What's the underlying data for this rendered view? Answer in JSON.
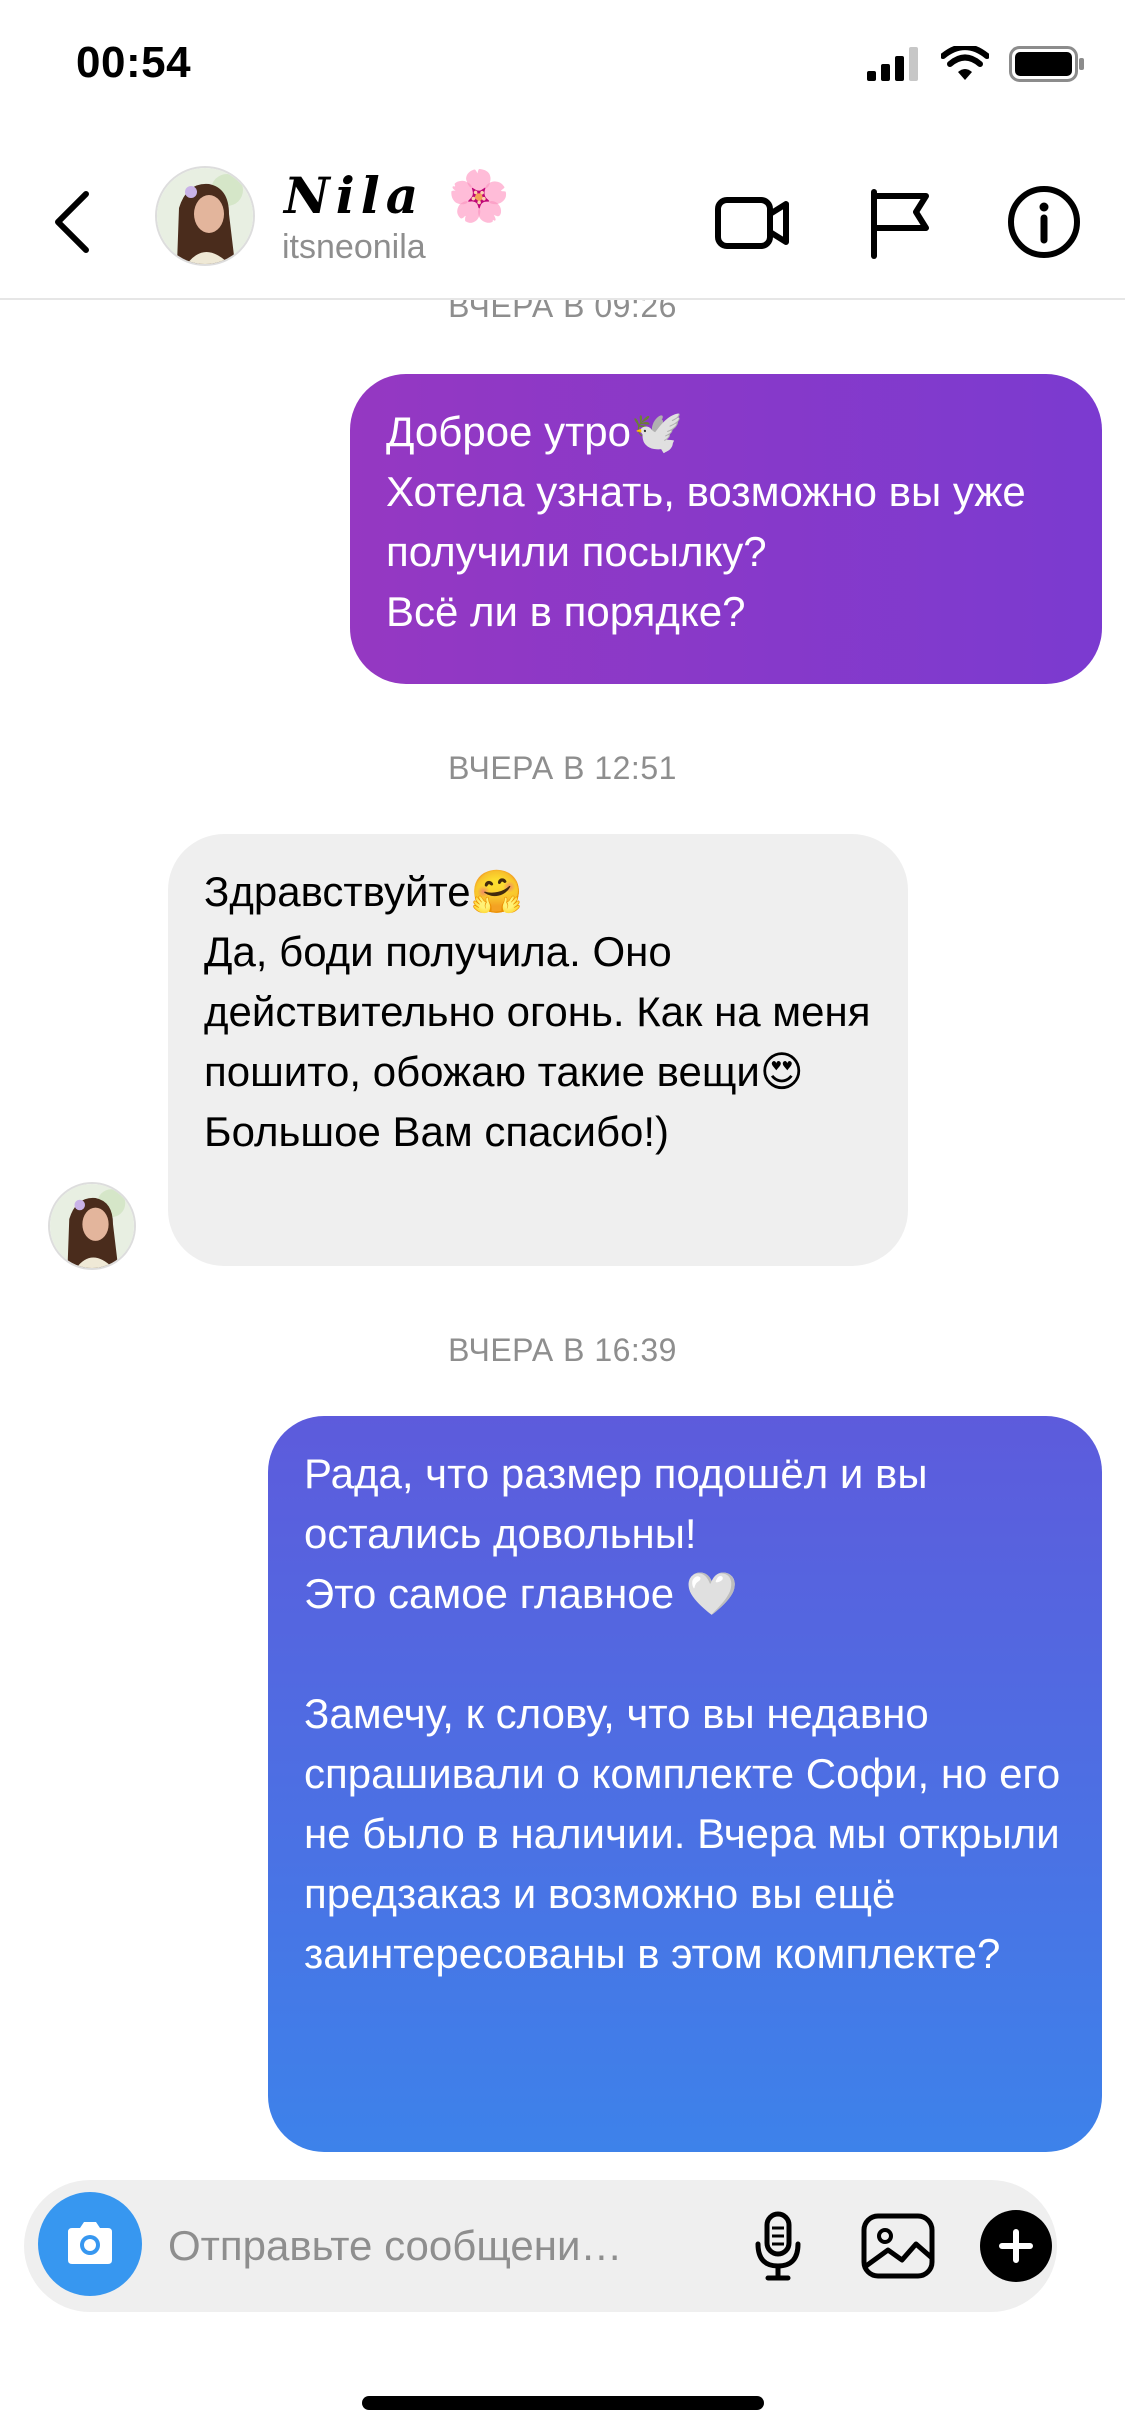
{
  "status_bar": {
    "time": "00:54"
  },
  "header": {
    "contact_name": "Nila",
    "name_emoji": "🌸",
    "handle": "itsneonila",
    "icons": [
      "back-icon",
      "video-call-icon",
      "flag-icon",
      "info-icon"
    ]
  },
  "messages": [
    {
      "timestamp": "ВЧЕРА В 09:26"
    },
    {
      "direction": "out",
      "text": "Доброе утро🕊️\nХотела узнать, возможно  вы уже получили посылку?\nВсё ли в порядке?"
    },
    {
      "timestamp": "ВЧЕРА В 12:51"
    },
    {
      "direction": "in",
      "text": "Здравствуйте🤗\nДа, боди получила. Оно действительно огонь. Как на меня пошито, обожаю такие вещи😍\nБольшое Вам спасибо!)"
    },
    {
      "timestamp": "ВЧЕРА В 16:39"
    },
    {
      "direction": "out",
      "text": "Рада, что размер подошёл и вы остались довольны!\nЭто самое главное 🤍\n\nЗамечу, к слову, что вы недавно спрашивали о комплекте Софи, но его не было в наличии. Вчера мы открыли предзаказ и возможно вы ещё заинтересованы в этом комплекте?"
    }
  ],
  "composer": {
    "placeholder": "Отправьте сообщени…",
    "icons": [
      "camera-icon",
      "microphone-icon",
      "gallery-icon",
      "plus-icon"
    ]
  },
  "colors": {
    "outgoing_purple": "#8b3bcc",
    "outgoing_blue_top": "#5d5bdc",
    "outgoing_blue_bottom": "#3d82ea",
    "incoming_bg": "#efefef",
    "camera_button": "#3797f0",
    "muted_text": "#8e8e8e"
  }
}
